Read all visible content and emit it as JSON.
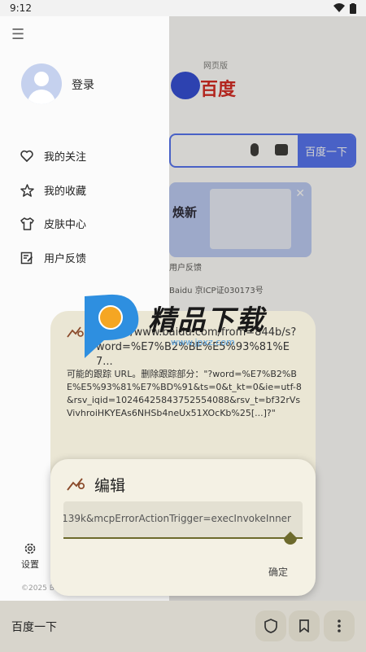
{
  "status_bar": {
    "time": "9:12"
  },
  "background_page": {
    "logo_text": "百度",
    "logo_tag": "网页版",
    "search_button": "百度一下",
    "banner_title": "焕新",
    "footer_link": "用户反馈",
    "footer_icp": "Baidu 京ICP证030173号"
  },
  "drawer": {
    "login": "登录",
    "items": [
      {
        "label": "我的关注",
        "icon": "heart-icon"
      },
      {
        "label": "我的收藏",
        "icon": "star-icon"
      },
      {
        "label": "皮肤中心",
        "icon": "shirt-icon"
      },
      {
        "label": "用户反馈",
        "icon": "feedback-icon"
      }
    ],
    "settings": "设置",
    "copyright": "©2025 B"
  },
  "watermark": {
    "text": "精品下载",
    "url": "www.jpxz.com"
  },
  "back_dialog": {
    "url": "https://www.baidu.com/from=844b/s?word=%E7%B2%BE%E5%93%81%E7...",
    "message": "可能的跟踪 URL。删除跟踪部分：\"?word=%E7%B2%BE%E5%93%81%E7%BD%91&ts=0&t_kt=0&ie=utf-8&rsv_iqid=10246425843752554088&rsv_t=bf32rVsVivhroiHKYEAs6NHSb4neUx51XOcKb%25[...]?\""
  },
  "edit_dialog": {
    "title": "编辑",
    "field_value": "139k&mcpErrorActionTrigger=execInvokeInner",
    "ok_button": "确定"
  },
  "bottom_bar": {
    "title": "百度一下"
  },
  "colors": {
    "accent": "#6d6a2c",
    "baidu_blue": "#4e6ef2",
    "baidu_red": "#d4211c"
  }
}
